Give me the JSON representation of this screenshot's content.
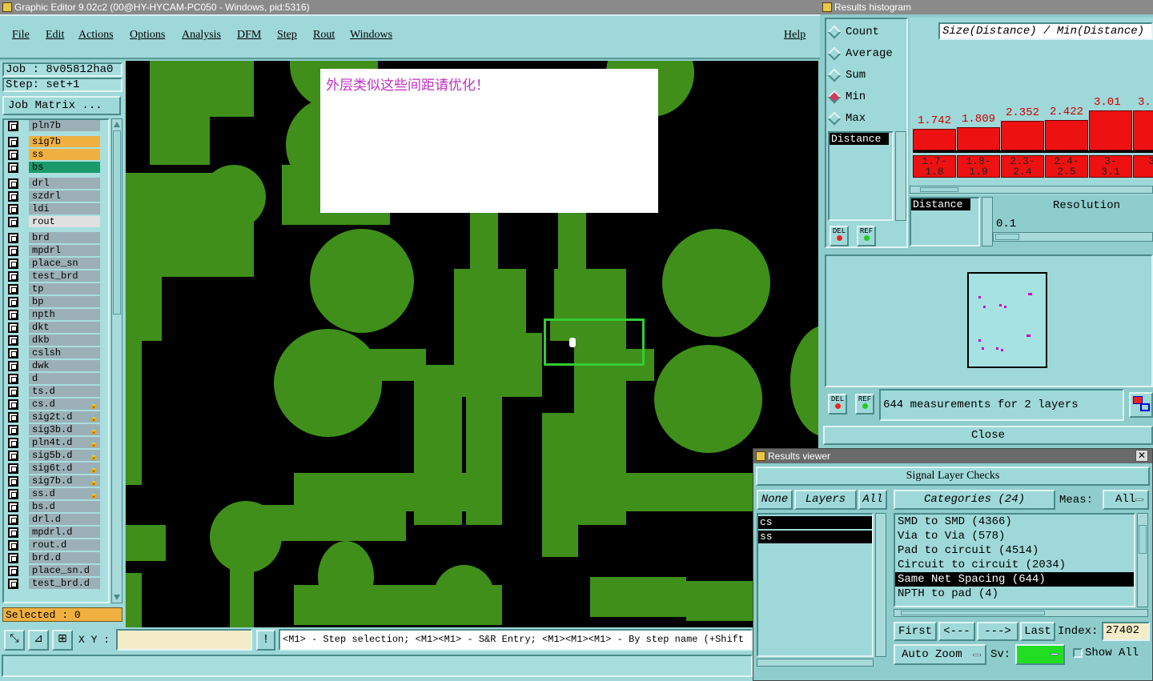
{
  "main_window": {
    "title": "Graphic Editor 9.02c2 (00@HY-HYCAM-PC050 - Windows, pid:5316)",
    "menu": [
      "File",
      "Edit",
      "Actions",
      "Options",
      "Analysis",
      "DFM",
      "Step",
      "Rout",
      "Windows"
    ],
    "help": "Help"
  },
  "job": {
    "job_label": "Job : 8v05812ha0",
    "step_label": "Step: set+1",
    "matrix_button": "Job Matrix ..."
  },
  "layers": [
    {
      "name": "pln7b",
      "color": "#9bb0b6"
    },
    {
      "name": "sig7b",
      "color": "#f0b040"
    },
    {
      "name": "ss",
      "color": "#f0b040"
    },
    {
      "name": "bs",
      "color": "#1a9a6a"
    },
    {
      "name": "drl",
      "color": "#9bb0b6"
    },
    {
      "name": "szdrl",
      "color": "#9bb0b6"
    },
    {
      "name": "ldi",
      "color": "#9bb0b6"
    },
    {
      "name": "rout",
      "color": "#e0e0e0"
    },
    {
      "name": "brd",
      "color": "#9bb0b6"
    },
    {
      "name": "mpdrl",
      "color": "#9bb0b6"
    },
    {
      "name": "place_sn",
      "color": "#9bb0b6"
    },
    {
      "name": "test_brd",
      "color": "#9bb0b6"
    },
    {
      "name": "tp",
      "color": "#9bb0b6"
    },
    {
      "name": "bp",
      "color": "#9bb0b6"
    },
    {
      "name": "npth",
      "color": "#9bb0b6"
    },
    {
      "name": "dkt",
      "color": "#9bb0b6"
    },
    {
      "name": "dkb",
      "color": "#9bb0b6"
    },
    {
      "name": "cslsh",
      "color": "#9bb0b6"
    },
    {
      "name": "dwk",
      "color": "#9bb0b6"
    },
    {
      "name": "d",
      "color": "#9bb0b6"
    },
    {
      "name": "ts.d",
      "color": "#9bb0b6"
    },
    {
      "name": "cs.d",
      "color": "#9bb0b6",
      "locked": true
    },
    {
      "name": "sig2t.d",
      "color": "#9bb0b6",
      "locked": true
    },
    {
      "name": "sig3b.d",
      "color": "#9bb0b6",
      "locked": true
    },
    {
      "name": "pln4t.d",
      "color": "#9bb0b6",
      "locked": true
    },
    {
      "name": "sig5b.d",
      "color": "#9bb0b6",
      "locked": true
    },
    {
      "name": "sig6t.d",
      "color": "#9bb0b6",
      "locked": true
    },
    {
      "name": "sig7b.d",
      "color": "#9bb0b6",
      "locked": true
    },
    {
      "name": "ss.d",
      "color": "#9bb0b6",
      "locked": true
    },
    {
      "name": "bs.d",
      "color": "#9bb0b6"
    },
    {
      "name": "drl.d",
      "color": "#9bb0b6"
    },
    {
      "name": "mpdrl.d",
      "color": "#9bb0b6"
    },
    {
      "name": "rout.d",
      "color": "#9bb0b6"
    },
    {
      "name": "brd.d",
      "color": "#9bb0b6"
    },
    {
      "name": "place_sn.d",
      "color": "#9bb0b6"
    },
    {
      "name": "test_brd.d",
      "color": "#9bb0b6"
    }
  ],
  "selected_label": "Selected : 0",
  "note_text": "外层类似这些间距请优化！",
  "status": {
    "xy_label": "X Y :",
    "xy_value": "",
    "bang": "!",
    "hint": "<M1> - Step selection; <M1><M1> - S&R Entry; <M1><M1><M1> - By step name (+Shift - Action)"
  },
  "histogram": {
    "title": "Results histogram",
    "options": [
      {
        "label": "Count",
        "selected": false
      },
      {
        "label": "Average",
        "selected": false
      },
      {
        "label": "Sum",
        "selected": false
      },
      {
        "label": "Min",
        "selected": true
      },
      {
        "label": "Max",
        "selected": false
      }
    ],
    "field_list": [
      "Distance"
    ],
    "header": "Size(Distance) / Min(Distance)",
    "bar_values": [
      "1.742",
      "1.809",
      "2.352",
      "2.422",
      "3.01",
      "3."
    ],
    "bar_levels": [
      0.27,
      0.29,
      0.37,
      0.38,
      0.5,
      0.5
    ],
    "bins": [
      [
        "1.7-",
        "1.8"
      ],
      [
        "1.8-",
        "1.9"
      ],
      [
        "2.3-",
        "2.4"
      ],
      [
        "2.4-",
        "2.5"
      ],
      [
        "3-",
        "3.1"
      ],
      [
        "3.",
        ""
      ]
    ],
    "res_field": "Distance",
    "resolution_label": "Resolution",
    "resolution_value": "0.1",
    "del": "DEL",
    "ref": "REF",
    "measurements": "644 measurements for 2 layers",
    "close": "Close"
  },
  "viewer": {
    "title": "Results viewer",
    "header": "Signal Layer Checks",
    "none": "None",
    "layers_btn": "Layers",
    "all": "All",
    "layer_list": [
      "cs",
      "ss"
    ],
    "categories_btn": "Categories (24)",
    "meas_label": "Meas:",
    "meas_value": "All",
    "categories": [
      {
        "label": "SMD to SMD (4366)",
        "selected": false
      },
      {
        "label": "Via to Via (578)",
        "selected": false
      },
      {
        "label": "Pad to circuit (4514)",
        "selected": false
      },
      {
        "label": "Circuit to circuit (2034)",
        "selected": false
      },
      {
        "label": "Same Net Spacing (644)",
        "selected": true
      },
      {
        "label": "NPTH to pad (4)",
        "selected": false
      }
    ],
    "first": "First",
    "prev": "<---",
    "next": "--->",
    "last": "Last",
    "index_label": "Index:",
    "index_value": "27402",
    "auto_zoom": "Auto Zoom",
    "sv_label": "Sv:",
    "show_all": "Show All"
  }
}
